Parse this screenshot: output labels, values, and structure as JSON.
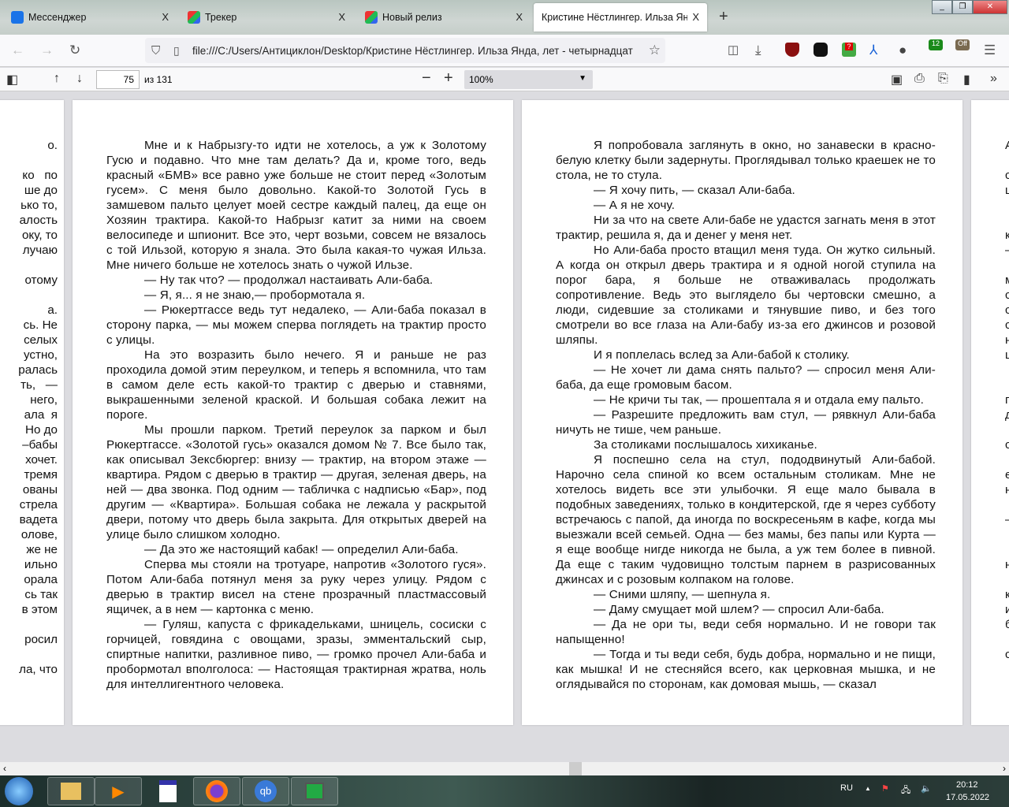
{
  "tabs": [
    {
      "label": "Мессенджер",
      "icon": "messenger-icon",
      "color": "#1a73e8"
    },
    {
      "label": "Трекер",
      "icon": "tracker-icon",
      "color": "#d63a8a"
    },
    {
      "label": "Новый релиз",
      "icon": "tracker-icon",
      "color": "#d63a8a"
    },
    {
      "label": "Кристине Нёстлингер. Ильза Янда",
      "icon": "",
      "color": "#fff"
    }
  ],
  "tab_close": "X",
  "url": "file:///C:/Users/Антициклон/Desktop/Кристине Нёстлингер. Ильза Янда, лет - четырнадцат",
  "ext_badges": {
    "red": "?",
    "green": "12",
    "off": "Off"
  },
  "pdf": {
    "page": "75",
    "of": "из 131",
    "zoom": "100%"
  },
  "left_fragments": [
    "о.",
    "",
    "ко   по",
    "ше до",
    "ько то,",
    "алость",
    "оку, то",
    "лучаю",
    "",
    "отому",
    "",
    "а.",
    "сь. Не",
    "селых",
    "устно,",
    "ралась",
    "ть,   —",
    "  него,",
    "ала  я",
    " Но до",
    "–бабы",
    "хочет.",
    "тремя",
    "ованы",
    "стрела",
    "вадета",
    "олове,",
    "же не",
    "ильно",
    "орала",
    "сь так",
    "в этом",
    "",
    "росил",
    "",
    "ла, что"
  ],
  "right_fragments": [
    "А",
    "",
    "с",
    "ц",
    "",
    "",
    "к",
    "–",
    "",
    "м",
    "с",
    "с",
    "с",
    "н",
    "ц",
    "",
    "",
    "г",
    "д",
    "",
    "с",
    "",
    "е",
    "н",
    "",
    "–",
    "",
    "",
    "н",
    "",
    "к",
    "и",
    "б",
    "",
    "с"
  ],
  "page1": [
    "Мне и к Набрызгу-то идти не хотелось, а уж к Золотому Гусю и подавно. Что мне там делать? Да и, кроме того, ведь красный «БМВ» все равно уже больше не стоит перед «Золотым гусем». С меня было довольно. Какой-то Золотой Гусь в замшевом пальто целует моей сестре каждый палец, да еще он Хозяин трактира. Какой-то Набрызг катит за ними на своем велосипеде и шпионит. Все это, черт возьми, совсем не вязалось с той Ильзой, которую я знала. Это была какая-то чужая Ильза. Мне ничего больше не хотелось знать о чужой Ильзе.",
    "— Ну так что? — продолжал настаивать Али-баба.",
    "— Я, я... я не знаю,— пробормотала я.",
    "— Рюкертгассе ведь тут недалеко, — Али-баба показал в сторону парка, — мы можем сперва поглядеть на трактир просто с улицы.",
    "На это возразить было нечего. Я и раньше не раз проходила домой этим переулком, и теперь я вспомнила, что там в самом деле есть какой-то трактир с дверью и ставнями, выкрашенными зеленой краской. И большая собака лежит на пороге.",
    "Мы прошли парком. Третий переулок за парком и был Рюкертгассе. «Золотой гусь» оказался домом № 7. Все было так, как описывал Зексбюргер: внизу — трактир, на втором этаже — квартира. Рядом с дверью в трактир — другая, зеленая дверь, на ней — два звонка. Под одним — табличка с надписью «Бар», под другим — «Квартира». Большая собака не лежала у раскрытой двери, потому что дверь была закрыта. Для открытых дверей на улице было слишком холодно.",
    "— Да это же настоящий кабак! — определил Али-баба.",
    "Сперва мы стояли на тротуаре, напротив «Золотого гуся». Потом Али-баба потянул меня за руку через улицу. Рядом с дверью в трактир висел на стене прозрачный пластмассовый ящичек, а в нем — картонка с меню.",
    "— Гуляш, капуста с фрикадельками, шницель, сосиски с горчицей, говядина с овощами, зразы, эмментальский сыр, спиртные напитки, разливное пиво, — громко прочел Али-баба и пробормотал вполголоса: — Настоящая трактирная жратва, ноль для интеллигентного человека."
  ],
  "page2": [
    "Я попробовала заглянуть в окно, но занавески в красно-белую клетку были задернуты. Проглядывал только краешек не то стола, не то стула.",
    "— Я хочу пить, — сказал Али-баба.",
    "— А я не хочу.",
    "Ни за что на свете Али-бабе не удастся загнать меня в этот трактир, решила я, да и денег у меня нет.",
    "Но Али-баба просто втащил меня туда. Он жутко сильный. А когда он открыл дверь трактира и я одной ногой ступила на порог бара, я больше не отваживалась продолжать сопротивление. Ведь это выглядело бы чертовски смешно, а люди, сидевшие за столиками и тянувшие пиво, и без того смотрели во все глаза на Али-бабу из-за его джинсов и розовой шляпы.",
    "И я поплелась вслед за Али-бабой к столику.",
    "— Не хочет ли дама снять пальто? — спросил меня Али-баба, да еще громовым басом.",
    "— Не кричи ты так, — прошептала я и отдала ему пальто.",
    "— Разрешите предложить вам стул, — рявкнул Али-баба ничуть не тише, чем раньше.",
    "За столиками послышалось хихиканье.",
    "Я поспешно села на стул, пододвинутый Али-бабой. Нарочно села спиной ко всем остальным столикам. Мне не хотелось видеть все эти улыбочки. Я еще мало бывала в подобных заведениях, только в кондитерской, где я через субботу встречаюсь с папой, да иногда по воскресеньям в кафе, когда мы выезжали всей семьей. Одна — без мамы, без папы или Курта — я еще вообще нигде никогда не была, а уж тем более в пивной. Да еще с таким чудовищно толстым парнем в разрисованных джинсах и с розовым колпаком на голове.",
    "— Сними шляпу, — шепнула я.",
    "— Даму смущает мой шлем? — спросил Али-баба.",
    "— Да не ори ты, веди себя нормально. И не говори так напыщенно!",
    "— Тогда и ты веди себя, будь добра, нормально и не пищи, как мышка! И не стесняйся всего, как церковная мышка, и не оглядывайся по сторонам, как домовая мышь, — сказал"
  ],
  "taskbar": {
    "lang": "RU",
    "time": "20:12",
    "date": "17.05.2022"
  }
}
